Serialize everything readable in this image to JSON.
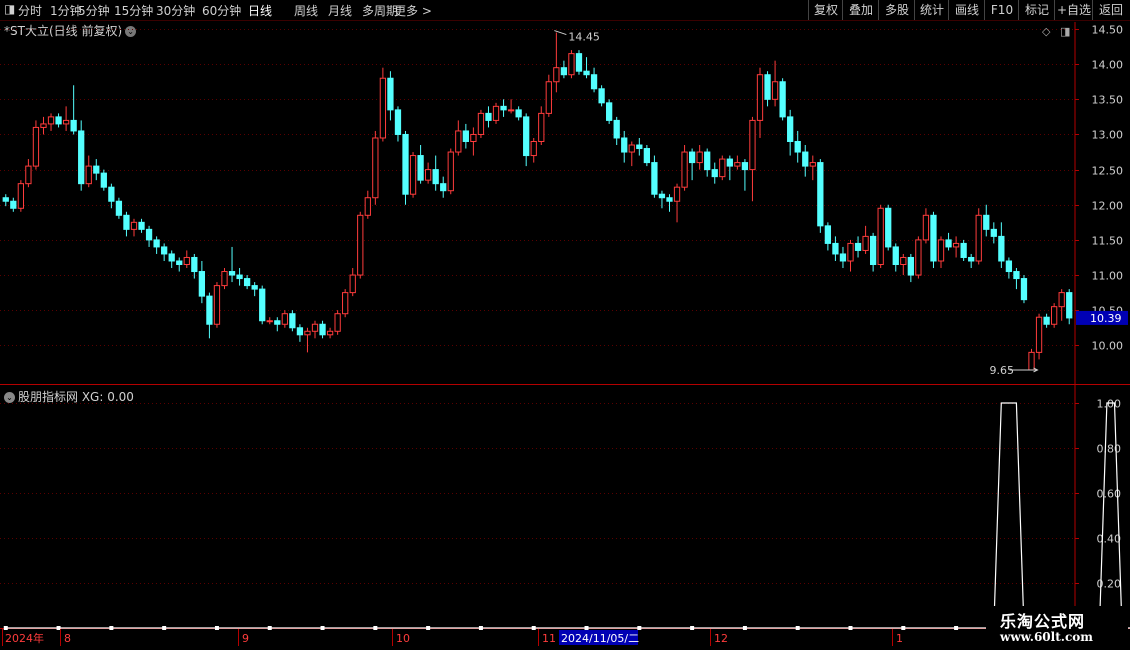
{
  "toolbar": {
    "periods": [
      "分时",
      "1分钟",
      "5分钟",
      "15分钟",
      "30分钟",
      "60分钟",
      "日线",
      "周线",
      "月线",
      "多周期",
      "更多 >"
    ],
    "active_period": "日线",
    "right_buttons": [
      "复权",
      "叠加",
      "多股",
      "统计",
      "画线",
      "F10",
      "标记",
      "+自选",
      "返回"
    ]
  },
  "main_panel": {
    "title": "*ST大立(日线 前复权)",
    "high_label": "14.45",
    "low_label": "9.65",
    "last_price": "10.39",
    "last_price_color": "#0000b4"
  },
  "indicator_panel": {
    "title": "股朋指标网 XG: 0.00"
  },
  "date_axis": {
    "labels": [
      "2024年",
      "8",
      "9",
      "10",
      "11",
      "12",
      "1"
    ],
    "cursor_label": "2024/11/05/二"
  },
  "watermark": {
    "title": "乐淘公式网",
    "url": "www.60lt.com"
  },
  "colors": {
    "up": "#ff3c3c",
    "down": "#54ffff",
    "frame": "#b40000",
    "grid": "#5a0000",
    "axis_text": "#d0d0d0"
  },
  "chart_data": [
    {
      "type": "candlestick",
      "title": "*ST大立(日线 前复权)",
      "y_ticks": [
        10.0,
        10.5,
        11.0,
        11.5,
        12.0,
        12.5,
        13.0,
        13.5,
        14.0,
        14.5
      ],
      "ylim": [
        9.45,
        14.6
      ],
      "ohlc": [
        [
          12.1,
          12.15,
          11.98,
          12.05
        ],
        [
          12.05,
          12.1,
          11.9,
          11.95
        ],
        [
          11.95,
          12.35,
          11.9,
          12.3
        ],
        [
          12.3,
          12.65,
          12.25,
          12.55
        ],
        [
          12.55,
          13.2,
          12.5,
          13.1
        ],
        [
          13.1,
          13.25,
          13.0,
          13.15
        ],
        [
          13.15,
          13.3,
          13.05,
          13.25
        ],
        [
          13.25,
          13.3,
          13.1,
          13.15
        ],
        [
          13.15,
          13.4,
          13.05,
          13.2
        ],
        [
          13.2,
          13.7,
          13.0,
          13.05
        ],
        [
          13.05,
          13.2,
          12.2,
          12.3
        ],
        [
          12.3,
          12.7,
          12.25,
          12.55
        ],
        [
          12.55,
          12.65,
          12.35,
          12.45
        ],
        [
          12.45,
          12.5,
          12.2,
          12.25
        ],
        [
          12.25,
          12.3,
          11.95,
          12.05
        ],
        [
          12.05,
          12.1,
          11.8,
          11.85
        ],
        [
          11.85,
          11.9,
          11.55,
          11.65
        ],
        [
          11.65,
          11.8,
          11.55,
          11.75
        ],
        [
          11.75,
          11.8,
          11.6,
          11.65
        ],
        [
          11.65,
          11.7,
          11.4,
          11.5
        ],
        [
          11.5,
          11.55,
          11.3,
          11.4
        ],
        [
          11.4,
          11.45,
          11.2,
          11.3
        ],
        [
          11.3,
          11.35,
          11.1,
          11.2
        ],
        [
          11.2,
          11.25,
          11.05,
          11.15
        ],
        [
          11.15,
          11.35,
          11.1,
          11.25
        ],
        [
          11.25,
          11.3,
          10.95,
          11.05
        ],
        [
          11.05,
          11.2,
          10.6,
          10.7
        ],
        [
          10.7,
          10.75,
          10.1,
          10.3
        ],
        [
          10.3,
          10.9,
          10.25,
          10.85
        ],
        [
          10.85,
          11.1,
          10.8,
          11.05
        ],
        [
          11.05,
          11.4,
          10.9,
          11.0
        ],
        [
          11.0,
          11.1,
          10.85,
          10.95
        ],
        [
          10.95,
          11.0,
          10.8,
          10.85
        ],
        [
          10.85,
          10.9,
          10.7,
          10.8
        ],
        [
          10.8,
          10.85,
          10.3,
          10.35
        ],
        [
          10.35,
          10.4,
          10.3,
          10.35
        ],
        [
          10.35,
          10.4,
          10.2,
          10.3
        ],
        [
          10.3,
          10.5,
          10.25,
          10.45
        ],
        [
          10.45,
          10.5,
          10.2,
          10.25
        ],
        [
          10.25,
          10.3,
          10.05,
          10.15
        ],
        [
          10.15,
          10.25,
          9.9,
          10.2
        ],
        [
          10.2,
          10.35,
          10.1,
          10.3
        ],
        [
          10.3,
          10.35,
          10.1,
          10.15
        ],
        [
          10.15,
          10.25,
          10.1,
          10.2
        ],
        [
          10.2,
          10.5,
          10.15,
          10.45
        ],
        [
          10.45,
          10.8,
          10.4,
          10.75
        ],
        [
          10.75,
          11.1,
          10.7,
          11.0
        ],
        [
          11.0,
          11.9,
          10.95,
          11.85
        ],
        [
          11.85,
          12.2,
          11.8,
          12.1
        ],
        [
          12.1,
          13.05,
          12.0,
          12.95
        ],
        [
          12.95,
          13.95,
          12.9,
          13.8
        ],
        [
          13.8,
          13.9,
          13.2,
          13.35
        ],
        [
          13.35,
          13.4,
          12.9,
          13.0
        ],
        [
          13.0,
          13.05,
          12.0,
          12.15
        ],
        [
          12.15,
          12.75,
          12.1,
          12.7
        ],
        [
          12.7,
          12.85,
          12.3,
          12.35
        ],
        [
          12.35,
          12.6,
          12.3,
          12.5
        ],
        [
          12.5,
          12.7,
          12.2,
          12.3
        ],
        [
          12.3,
          12.4,
          12.1,
          12.2
        ],
        [
          12.2,
          12.8,
          12.15,
          12.75
        ],
        [
          12.75,
          13.2,
          12.7,
          13.05
        ],
        [
          13.05,
          13.15,
          12.8,
          12.9
        ],
        [
          12.9,
          13.1,
          12.7,
          13.0
        ],
        [
          13.0,
          13.35,
          12.95,
          13.3
        ],
        [
          13.3,
          13.4,
          13.1,
          13.2
        ],
        [
          13.2,
          13.45,
          13.15,
          13.4
        ],
        [
          13.4,
          13.5,
          13.25,
          13.35
        ],
        [
          13.35,
          13.5,
          13.3,
          13.35
        ],
        [
          13.35,
          13.4,
          13.2,
          13.25
        ],
        [
          13.25,
          13.3,
          12.55,
          12.7
        ],
        [
          12.7,
          12.95,
          12.6,
          12.9
        ],
        [
          12.9,
          13.4,
          12.85,
          13.3
        ],
        [
          13.3,
          13.85,
          13.25,
          13.75
        ],
        [
          13.75,
          14.45,
          13.6,
          13.95
        ],
        [
          13.95,
          14.05,
          13.8,
          13.85
        ],
        [
          13.85,
          14.2,
          13.8,
          14.15
        ],
        [
          14.15,
          14.2,
          13.85,
          13.9
        ],
        [
          13.9,
          14.1,
          13.8,
          13.85
        ],
        [
          13.85,
          13.95,
          13.6,
          13.65
        ],
        [
          13.65,
          13.7,
          13.4,
          13.45
        ],
        [
          13.45,
          13.5,
          13.15,
          13.2
        ],
        [
          13.2,
          13.25,
          12.85,
          12.95
        ],
        [
          12.95,
          13.05,
          12.6,
          12.75
        ],
        [
          12.75,
          12.9,
          12.55,
          12.85
        ],
        [
          12.85,
          12.95,
          12.7,
          12.8
        ],
        [
          12.8,
          12.85,
          12.55,
          12.6
        ],
        [
          12.6,
          12.7,
          12.1,
          12.15
        ],
        [
          12.15,
          12.2,
          11.95,
          12.1
        ],
        [
          12.1,
          12.15,
          11.9,
          12.05
        ],
        [
          12.05,
          12.3,
          11.75,
          12.25
        ],
        [
          12.25,
          12.85,
          12.2,
          12.75
        ],
        [
          12.75,
          12.8,
          12.35,
          12.6
        ],
        [
          12.6,
          12.85,
          12.5,
          12.75
        ],
        [
          12.75,
          12.8,
          12.4,
          12.5
        ],
        [
          12.5,
          12.6,
          12.3,
          12.4
        ],
        [
          12.4,
          12.7,
          12.35,
          12.65
        ],
        [
          12.65,
          12.7,
          12.35,
          12.55
        ],
        [
          12.55,
          12.7,
          12.5,
          12.6
        ],
        [
          12.6,
          12.65,
          12.2,
          12.5
        ],
        [
          12.5,
          13.25,
          12.05,
          13.2
        ],
        [
          13.2,
          13.95,
          12.95,
          13.85
        ],
        [
          13.85,
          13.9,
          13.4,
          13.5
        ],
        [
          13.5,
          14.05,
          13.4,
          13.75
        ],
        [
          13.75,
          13.8,
          13.2,
          13.25
        ],
        [
          13.25,
          13.35,
          12.7,
          12.9
        ],
        [
          12.9,
          13.05,
          12.6,
          12.75
        ],
        [
          12.75,
          12.85,
          12.4,
          12.55
        ],
        [
          12.55,
          12.7,
          12.35,
          12.6
        ],
        [
          12.6,
          12.65,
          11.6,
          11.7
        ],
        [
          11.7,
          11.75,
          11.35,
          11.45
        ],
        [
          11.45,
          11.55,
          11.2,
          11.3
        ],
        [
          11.3,
          11.4,
          11.1,
          11.2
        ],
        [
          11.2,
          11.5,
          11.05,
          11.45
        ],
        [
          11.45,
          11.55,
          11.25,
          11.35
        ],
        [
          11.35,
          11.7,
          11.3,
          11.55
        ],
        [
          11.55,
          11.6,
          11.05,
          11.15
        ],
        [
          11.15,
          12.0,
          11.1,
          11.95
        ],
        [
          11.95,
          12.0,
          11.35,
          11.4
        ],
        [
          11.4,
          11.45,
          11.05,
          11.15
        ],
        [
          11.15,
          11.3,
          11.0,
          11.25
        ],
        [
          11.25,
          11.3,
          10.9,
          11.0
        ],
        [
          11.0,
          11.55,
          10.95,
          11.5
        ],
        [
          11.5,
          11.95,
          11.45,
          11.85
        ],
        [
          11.85,
          11.9,
          11.1,
          11.2
        ],
        [
          11.2,
          11.55,
          11.1,
          11.5
        ],
        [
          11.5,
          11.6,
          11.35,
          11.4
        ],
        [
          11.4,
          11.55,
          11.25,
          11.45
        ],
        [
          11.45,
          11.5,
          11.2,
          11.25
        ],
        [
          11.25,
          11.3,
          11.1,
          11.2
        ],
        [
          11.2,
          11.95,
          11.15,
          11.85
        ],
        [
          11.85,
          12.0,
          11.55,
          11.65
        ],
        [
          11.65,
          11.75,
          11.45,
          11.55
        ],
        [
          11.55,
          11.75,
          11.1,
          11.2
        ],
        [
          11.2,
          11.25,
          10.95,
          11.05
        ],
        [
          11.05,
          11.1,
          10.8,
          10.95
        ],
        [
          10.95,
          11.0,
          10.6,
          10.65
        ],
        [
          9.65,
          9.95,
          9.65,
          9.9
        ],
        [
          9.9,
          10.45,
          9.8,
          10.4
        ],
        [
          10.4,
          10.45,
          10.25,
          10.3
        ],
        [
          10.3,
          10.6,
          10.25,
          10.55
        ],
        [
          10.55,
          10.8,
          10.35,
          10.75
        ],
        [
          10.75,
          10.8,
          10.3,
          10.39
        ]
      ]
    },
    {
      "type": "line",
      "title": "股朋指标网",
      "series": [
        {
          "name": "XG",
          "last_value": 0.0
        }
      ],
      "y_ticks": [
        0.2,
        0.4,
        0.6,
        0.8,
        1.0
      ],
      "ylim": [
        0,
        1.08
      ],
      "segments": [
        {
          "value": 0,
          "from": 0,
          "to": 131
        },
        {
          "value": 1,
          "from": 132,
          "to": 134
        },
        {
          "value": 0,
          "from": 135,
          "to": 145
        },
        {
          "value": 1,
          "from": 146,
          "to": 147
        },
        {
          "value": 0,
          "from": 148,
          "to": 153
        }
      ]
    }
  ]
}
